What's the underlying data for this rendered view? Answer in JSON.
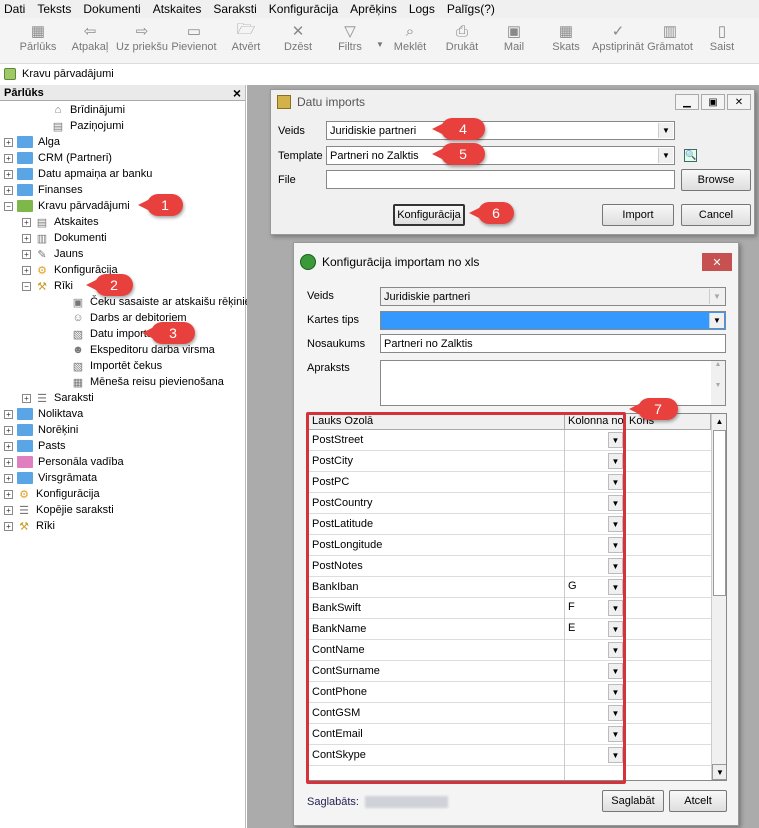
{
  "menubar": [
    "Dati",
    "Teksts",
    "Dokumenti",
    "Atskaites",
    "Saraksti",
    "Konfigurācija",
    "Aprēķins",
    "Logs",
    "Palīgs(?)"
  ],
  "toolbar": [
    {
      "label": "Pārlūks",
      "icon": "browser-icon"
    },
    {
      "label": "Atpakaļ",
      "icon": "back-arrow-icon"
    },
    {
      "label": "Uz priekšu",
      "icon": "forward-arrow-icon"
    },
    {
      "label": "Pievienot",
      "icon": "add-icon"
    },
    {
      "label": "Atvērt",
      "icon": "open-folder-icon"
    },
    {
      "label": "Dzēst",
      "icon": "delete-x-icon"
    },
    {
      "label": "Filtrs",
      "icon": "filter-icon"
    },
    {
      "label": "Meklēt",
      "icon": "search-icon"
    },
    {
      "label": "Drukāt",
      "icon": "print-icon"
    },
    {
      "label": "Mail",
      "icon": "mail-icon"
    },
    {
      "label": "Skats",
      "icon": "view-grid-icon"
    },
    {
      "label": "Apstiprināt",
      "icon": "approve-icon"
    },
    {
      "label": "Grāmatot",
      "icon": "book-icon"
    },
    {
      "label": "Saist",
      "icon": "link-icon"
    }
  ],
  "tab_title": "Kravu pārvadājumi",
  "left_panel": {
    "title": "Pārlūks",
    "close": "×",
    "tree": [
      {
        "label": "Brīdinājumi",
        "level": 2,
        "icon": "house-icon"
      },
      {
        "label": "Paziņojumi",
        "level": 2,
        "icon": "document-icon"
      },
      {
        "label": "Alga",
        "level": 0,
        "icon": "folder-icon",
        "exp": "+"
      },
      {
        "label": "CRM (Partneri)",
        "level": 0,
        "icon": "folder-icon",
        "exp": "+"
      },
      {
        "label": "Datu apmaiņa ar banku",
        "level": 0,
        "icon": "folder-icon",
        "exp": "+"
      },
      {
        "label": "Finanses",
        "level": 0,
        "icon": "folder-icon",
        "exp": "+"
      },
      {
        "label": "Kravu pārvadājumi",
        "level": 0,
        "icon": "folder-green-icon",
        "exp": "−"
      },
      {
        "label": "Atskaites",
        "level": 1,
        "icon": "report-icon",
        "exp": "+"
      },
      {
        "label": "Dokumenti",
        "level": 1,
        "icon": "documents-icon",
        "exp": "+"
      },
      {
        "label": "Jauns",
        "level": 1,
        "icon": "new-doc-icon",
        "exp": "+"
      },
      {
        "label": "Konfigurācija",
        "level": 1,
        "icon": "gear-icon",
        "exp": "+"
      },
      {
        "label": "Rīki",
        "level": 1,
        "icon": "tools-icon",
        "exp": "−"
      },
      {
        "label": "Čeku sasaiste ar atskaišu rēķiniem",
        "level": 3,
        "icon": "receipt-icon"
      },
      {
        "label": "Darbs ar debitoriem",
        "level": 3,
        "icon": "people-icon"
      },
      {
        "label": "Datu imports",
        "level": 3,
        "icon": "import-icon"
      },
      {
        "label": "Ekspeditoru darba virsma",
        "level": 3,
        "icon": "person-icon"
      },
      {
        "label": "Importēt čekus",
        "level": 3,
        "icon": "import-icon"
      },
      {
        "label": "Mēneša reisu pievienošana",
        "level": 3,
        "icon": "calendar-icon"
      },
      {
        "label": "Saraksti",
        "level": 1,
        "icon": "list-icon",
        "exp": "+"
      },
      {
        "label": "Noliktava",
        "level": 0,
        "icon": "folder-icon",
        "exp": "+"
      },
      {
        "label": "Norēķini",
        "level": 0,
        "icon": "folder-icon",
        "exp": "+"
      },
      {
        "label": "Pasts",
        "level": 0,
        "icon": "folder-icon",
        "exp": "+"
      },
      {
        "label": "Personāla vadība",
        "level": 0,
        "icon": "folder-pink-icon",
        "exp": "+"
      },
      {
        "label": "Virsgrāmata",
        "level": 0,
        "icon": "folder-icon",
        "exp": "+"
      },
      {
        "label": "Konfigurācija",
        "level": 0,
        "icon": "gear-icon",
        "exp": "+"
      },
      {
        "label": "Kopējie saraksti",
        "level": 0,
        "icon": "list-icon",
        "exp": "+"
      },
      {
        "label": "Rīki",
        "level": 0,
        "icon": "tools-icon",
        "exp": "+"
      }
    ]
  },
  "badges": [
    "1",
    "2",
    "3",
    "4",
    "5",
    "6",
    "7"
  ],
  "import_window": {
    "title": "Datu imports",
    "veids_label": "Veids",
    "veids_value": "Juridiskie partneri",
    "template_label": "Template",
    "template_value": "Partneri no Zalktis",
    "file_label": "File",
    "file_value": "",
    "browse": "Browse",
    "config_button": "Konfigurācija",
    "import_button": "Import",
    "cancel_button": "Cancel"
  },
  "config_window": {
    "title": "Konfigurācija importam no xls",
    "veids_label": "Veids",
    "veids_value": "Juridiskie partneri",
    "kartes_label": "Kartes tips",
    "nosaukums_label": "Nosaukums",
    "nosaukums_value": "Partneri no Zalktis",
    "apraksts_label": "Apraksts",
    "apraksts_value": "",
    "col_headers": [
      "Lauks Ozolā",
      "Kolonna no",
      "Kons"
    ],
    "rows": [
      {
        "field": "PostStreet",
        "col": ""
      },
      {
        "field": "PostCity",
        "col": ""
      },
      {
        "field": "PostPC",
        "col": ""
      },
      {
        "field": "PostCountry",
        "col": ""
      },
      {
        "field": "PostLatitude",
        "col": ""
      },
      {
        "field": "PostLongitude",
        "col": ""
      },
      {
        "field": "PostNotes",
        "col": ""
      },
      {
        "field": "BankIban",
        "col": "G"
      },
      {
        "field": "BankSwift",
        "col": "F"
      },
      {
        "field": "BankName",
        "col": "E"
      },
      {
        "field": "ContName",
        "col": ""
      },
      {
        "field": "ContSurname",
        "col": ""
      },
      {
        "field": "ContPhone",
        "col": ""
      },
      {
        "field": "ContGSM",
        "col": ""
      },
      {
        "field": "ContEmail",
        "col": ""
      },
      {
        "field": "ContSkype",
        "col": ""
      }
    ],
    "saved_label": "Saglabāts:",
    "save_button": "Saglabāt",
    "cancel_button": "Atcelt"
  },
  "colors": {
    "badge": "#e8403d",
    "highlight": "#d6323a",
    "selection": "#3399ff"
  }
}
